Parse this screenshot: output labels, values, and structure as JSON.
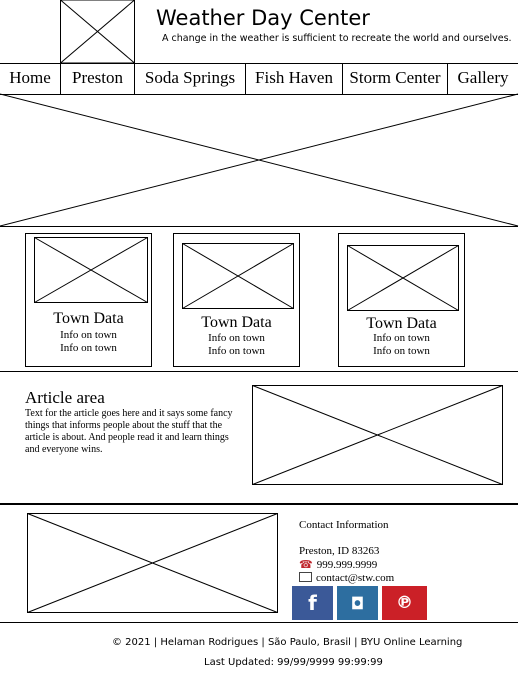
{
  "header": {
    "title": "Weather Day Center",
    "tagline": "A change in the weather is sufficient to recreate the world and ourselves."
  },
  "nav": [
    {
      "label": "Home"
    },
    {
      "label": "Preston"
    },
    {
      "label": "Soda Springs"
    },
    {
      "label": "Fish Haven"
    },
    {
      "label": "Storm Center"
    },
    {
      "label": "Gallery"
    }
  ],
  "towns": [
    {
      "title": "Town Data",
      "info1": "Info on town",
      "info2": "Info on town"
    },
    {
      "title": "Town Data",
      "info1": "Info on town",
      "info2": "Info on town"
    },
    {
      "title": "Town Data",
      "info1": "Info on town",
      "info2": "Info on town"
    }
  ],
  "article": {
    "title": "Article area",
    "text": "Text for the article goes here and it says some fancy things that informs people about the stuff that the article is about. And people read it and learn things and everyone wins."
  },
  "contact": {
    "heading": "Contact Information",
    "city": "Preston, ID 83263",
    "phone": "999.999.9999",
    "email": "contact@stw.com"
  },
  "social": [
    {
      "icon": "facebook-icon",
      "glyph": "f",
      "color": "#3b5998"
    },
    {
      "icon": "instagram-icon",
      "glyph": "◘",
      "color": "#2d6ea0"
    },
    {
      "icon": "pinterest-icon",
      "glyph": "℗",
      "color": "#cb2027"
    }
  ],
  "footer": {
    "copyright": "© 2021 |  Helaman Rodrigues  |  São Paulo, Brasil   |  BYU Online Learning",
    "updated": "Last Updated: 99/99/9999 99:99:99"
  }
}
